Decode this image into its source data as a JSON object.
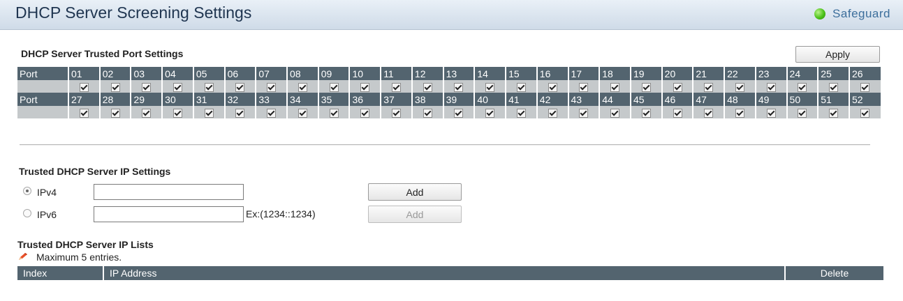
{
  "header": {
    "title": "DHCP Server Screening Settings",
    "safeguard": "Safeguard",
    "safeguard_color": "#4cc21a"
  },
  "trusted_port": {
    "title": "DHCP Server Trusted Port Settings",
    "apply_label": "Apply",
    "row_label": "Port",
    "rows": [
      [
        "01",
        "02",
        "03",
        "04",
        "05",
        "06",
        "07",
        "08",
        "09",
        "10",
        "11",
        "12",
        "13",
        "14",
        "15",
        "16",
        "17",
        "18",
        "19",
        "20",
        "21",
        "22",
        "23",
        "24",
        "25",
        "26"
      ],
      [
        "27",
        "28",
        "29",
        "30",
        "31",
        "32",
        "33",
        "34",
        "35",
        "36",
        "37",
        "38",
        "39",
        "40",
        "41",
        "42",
        "43",
        "44",
        "45",
        "46",
        "47",
        "48",
        "49",
        "50",
        "51",
        "52"
      ]
    ],
    "all_checked": true
  },
  "trusted_ip": {
    "title": "Trusted DHCP Server IP Settings",
    "ipv4_label": "IPv4",
    "ipv6_label": "IPv6",
    "ipv4_value": "",
    "ipv6_value": "",
    "ipv6_hint": "Ex:(1234::1234)",
    "add_label": "Add",
    "add2_label": "Add",
    "selected": "IPv4"
  },
  "ip_list": {
    "title": "Trusted DHCP Server IP Lists",
    "note": "Maximum 5 entries.",
    "columns": [
      "Index",
      "IP Address",
      "Delete"
    ]
  }
}
